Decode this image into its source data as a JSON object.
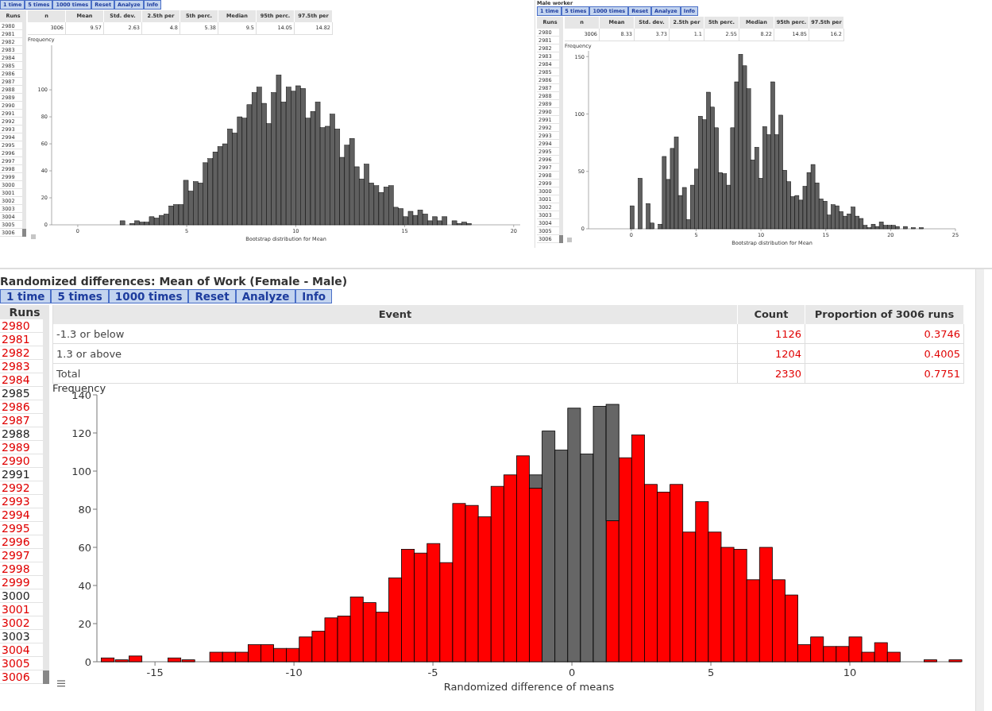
{
  "bootstrap_left": {
    "buttons": [
      "1 time",
      "5 times",
      "1000 times",
      "Reset",
      "Analyze",
      "Info"
    ],
    "runs_header": "Runs",
    "runs": [
      "2980",
      "2981",
      "2982",
      "2983",
      "2984",
      "2985",
      "2986",
      "2987",
      "2988",
      "2989",
      "2990",
      "2991",
      "2992",
      "2993",
      "2994",
      "2995",
      "2996",
      "2997",
      "2998",
      "2999",
      "3000",
      "3001",
      "3002",
      "3003",
      "3004",
      "3005",
      "3006"
    ],
    "stats": {
      "columns": [
        "n",
        "Mean",
        "Std. dev.",
        "2.5th per",
        "5th perc.",
        "Median",
        "95th perc.",
        "97.5th per"
      ],
      "values": [
        "3006",
        "9.57",
        "2.63",
        "4.8",
        "5.38",
        "9.5",
        "14.05",
        "14.82"
      ]
    },
    "chart_data": {
      "type": "bar",
      "xlabel": "Bootstrap distribution for Mean",
      "ylabel": "Frequency",
      "x": [
        2.05,
        2.27,
        2.5,
        2.72,
        2.95,
        3.17,
        3.39,
        3.62,
        3.84,
        4.07,
        4.29,
        4.51,
        4.74,
        4.96,
        5.19,
        5.41,
        5.63,
        5.86,
        6.08,
        6.31,
        6.53,
        6.75,
        6.98,
        7.2,
        7.43,
        7.65,
        7.87,
        8.1,
        8.32,
        8.55,
        8.77,
        8.99,
        9.22,
        9.44,
        9.67,
        9.89,
        10.11,
        10.34,
        10.56,
        10.79,
        11.01,
        11.23,
        11.46,
        11.68,
        11.91,
        12.13,
        12.35,
        12.58,
        12.8,
        13.03,
        13.25,
        13.47,
        13.7,
        13.92,
        14.15,
        14.37,
        14.59,
        14.82,
        15.04,
        15.27,
        15.49,
        15.71,
        15.94,
        16.16,
        16.39,
        16.61,
        16.83,
        17.06,
        17.28,
        17.51,
        17.73,
        17.95
      ],
      "values": [
        3,
        null,
        1,
        3,
        2,
        2,
        6,
        5,
        7,
        8,
        14,
        15,
        15,
        33,
        25,
        32,
        31,
        46,
        49,
        54,
        58,
        60,
        71,
        68,
        80,
        79,
        89,
        98,
        102,
        90,
        75,
        98,
        111,
        91,
        102,
        99,
        103,
        101,
        79,
        84,
        91,
        72,
        73,
        82,
        71,
        50,
        59,
        64,
        43,
        34,
        45,
        31,
        29,
        24,
        28,
        29,
        13,
        12,
        6,
        10,
        7,
        11,
        8,
        3,
        6,
        3,
        6,
        null,
        3,
        1,
        2,
        1
      ],
      "xlim": [
        -1.2,
        20.3
      ],
      "ylim": [
        0,
        133
      ],
      "xticks": [
        0,
        5,
        10,
        15,
        20
      ],
      "yticks": [
        0,
        20,
        40,
        60,
        80,
        100
      ]
    }
  },
  "bootstrap_right": {
    "title": "Male worker",
    "buttons": [
      "1 time",
      "5 times",
      "1000 times",
      "Reset",
      "Analyze",
      "Info"
    ],
    "runs_header": "Runs",
    "runs": [
      "2980",
      "2981",
      "2982",
      "2983",
      "2984",
      "2985",
      "2986",
      "2987",
      "2988",
      "2989",
      "2990",
      "2991",
      "2992",
      "2993",
      "2994",
      "2995",
      "2996",
      "2997",
      "2998",
      "2999",
      "3000",
      "3001",
      "3002",
      "3003",
      "3004",
      "3005",
      "3006"
    ],
    "stats": {
      "columns": [
        "n",
        "Mean",
        "Std. dev.",
        "2.5th per",
        "5th perc.",
        "Median",
        "95th perc.",
        "97.5th per"
      ],
      "values": [
        "3006",
        "8.33",
        "3.73",
        "1.1",
        "2.55",
        "8.22",
        "14.85",
        "16.2"
      ]
    },
    "chart_data": {
      "type": "bar",
      "xlabel": "Bootstrap distribution for Mean",
      "ylabel": "Frequency",
      "x": [
        0.06,
        0.37,
        0.68,
        0.99,
        1.3,
        1.61,
        1.92,
        2.23,
        2.54,
        2.85,
        3.16,
        3.47,
        3.78,
        4.09,
        4.4,
        4.71,
        5.02,
        5.33,
        5.64,
        5.95,
        6.26,
        6.57,
        6.88,
        7.19,
        7.5,
        7.81,
        8.12,
        8.43,
        8.74,
        9.05,
        9.36,
        9.67,
        9.98,
        10.29,
        10.6,
        10.91,
        11.22,
        11.53,
        11.84,
        12.15,
        12.46,
        12.77,
        13.08,
        13.39,
        13.7,
        14.01,
        14.32,
        14.63,
        14.94,
        15.25,
        15.56,
        15.87,
        16.18,
        16.49,
        16.8,
        17.11,
        17.42,
        17.73,
        18.04,
        18.35,
        18.66,
        18.97,
        19.28,
        19.59,
        19.9,
        20.21,
        20.52,
        20.83,
        21.14,
        21.45,
        21.76,
        22.07,
        22.38
      ],
      "values": [
        20,
        null,
        44,
        null,
        22,
        5,
        null,
        4,
        63,
        43,
        70,
        80,
        29,
        36,
        8,
        38,
        52,
        98,
        95,
        119,
        106,
        88,
        49,
        48,
        38,
        88,
        128,
        152,
        142,
        122,
        60,
        71,
        44,
        89,
        82,
        128,
        82,
        99,
        51,
        41,
        28,
        29,
        25,
        37,
        49,
        56,
        40,
        26,
        24,
        12,
        21,
        20,
        15,
        11,
        13,
        19,
        11,
        9,
        3,
        1,
        4,
        2,
        6,
        3,
        3,
        3,
        2,
        null,
        2,
        null,
        1,
        null,
        1
      ],
      "xlim": [
        -3.3,
        25
      ],
      "ylim": [
        0,
        155
      ],
      "xticks": [
        0,
        5,
        10,
        15,
        20,
        25
      ],
      "yticks": [
        0,
        50,
        100,
        150
      ]
    }
  },
  "randomization": {
    "title": "Randomized differences: Mean of Work (Female - Male)",
    "buttons": [
      "1 time",
      "5 times",
      "1000 times",
      "Reset",
      "Analyze",
      "Info"
    ],
    "runs_header": "Runs",
    "runs": [
      {
        "label": "2980",
        "in_event": true
      },
      {
        "label": "2981",
        "in_event": true
      },
      {
        "label": "2982",
        "in_event": true
      },
      {
        "label": "2983",
        "in_event": true
      },
      {
        "label": "2984",
        "in_event": true
      },
      {
        "label": "2985",
        "in_event": false
      },
      {
        "label": "2986",
        "in_event": true
      },
      {
        "label": "2987",
        "in_event": true
      },
      {
        "label": "2988",
        "in_event": false
      },
      {
        "label": "2989",
        "in_event": true
      },
      {
        "label": "2990",
        "in_event": true
      },
      {
        "label": "2991",
        "in_event": false
      },
      {
        "label": "2992",
        "in_event": true
      },
      {
        "label": "2993",
        "in_event": true
      },
      {
        "label": "2994",
        "in_event": true
      },
      {
        "label": "2995",
        "in_event": true
      },
      {
        "label": "2996",
        "in_event": true
      },
      {
        "label": "2997",
        "in_event": true
      },
      {
        "label": "2998",
        "in_event": true
      },
      {
        "label": "2999",
        "in_event": true
      },
      {
        "label": "3000",
        "in_event": false
      },
      {
        "label": "3001",
        "in_event": true
      },
      {
        "label": "3002",
        "in_event": true
      },
      {
        "label": "3003",
        "in_event": false
      },
      {
        "label": "3004",
        "in_event": true
      },
      {
        "label": "3005",
        "in_event": true
      },
      {
        "label": "3006",
        "in_event": true
      }
    ],
    "event_table": {
      "columns": [
        "Event",
        "Count",
        "Proportion of 3006 runs"
      ],
      "rows": [
        {
          "event": "-1.3 or below",
          "count": "1126",
          "proportion": "0.3746"
        },
        {
          "event": "1.3 or above",
          "count": "1204",
          "proportion": "0.4005"
        },
        {
          "event": "Total",
          "count": "2330",
          "proportion": "0.7751"
        }
      ]
    },
    "chart_data": {
      "type": "bar",
      "xlabel": "Randomized difference of means",
      "ylabel": "Frequency",
      "stacked": true,
      "x": [
        -16.7,
        -16.2,
        -15.7,
        -14.3,
        -13.8,
        -12.8,
        -12.34,
        -11.88,
        -11.42,
        -10.96,
        -10.5,
        -10.04,
        -9.58,
        -9.12,
        -8.66,
        -8.2,
        -7.74,
        -7.28,
        -6.82,
        -6.36,
        -5.9,
        -5.44,
        -4.98,
        -4.52,
        -4.06,
        -3.6,
        -3.14,
        -2.68,
        -2.22,
        -1.76,
        -1.3,
        -0.84,
        -0.38,
        0.08,
        0.54,
        1.0,
        1.46,
        1.92,
        2.38,
        2.84,
        3.3,
        3.76,
        4.22,
        4.68,
        5.14,
        5.6,
        6.06,
        6.52,
        6.98,
        7.44,
        7.9,
        8.36,
        8.82,
        9.28,
        9.74,
        10.2,
        10.66,
        11.12,
        11.58,
        12.9,
        13.8
      ],
      "series": [
        {
          "color": "#ff0000",
          "values": [
            2,
            1,
            3,
            2,
            1,
            5,
            5,
            5,
            9,
            9,
            7,
            7,
            13,
            16,
            23,
            24,
            34,
            31,
            26,
            44,
            59,
            57,
            62,
            52,
            83,
            82,
            76,
            92,
            98,
            108,
            91,
            null,
            null,
            null,
            null,
            null,
            74,
            107,
            119,
            93,
            89,
            93,
            68,
            84,
            68,
            60,
            59,
            43,
            60,
            43,
            35,
            9,
            13,
            8,
            8,
            13,
            5,
            10,
            5,
            1,
            1
          ]
        },
        {
          "color": "#666666",
          "values": [
            null,
            null,
            null,
            null,
            null,
            null,
            null,
            null,
            null,
            null,
            null,
            null,
            null,
            null,
            null,
            null,
            null,
            null,
            null,
            null,
            null,
            null,
            null,
            null,
            null,
            null,
            null,
            null,
            null,
            null,
            7,
            121,
            111,
            133,
            109,
            134,
            61,
            null,
            null,
            null,
            null,
            null,
            null,
            null,
            null,
            null,
            null,
            null,
            null,
            null,
            null,
            null,
            null,
            null,
            null,
            null,
            null,
            null,
            null,
            null,
            null
          ]
        }
      ],
      "xlim": [
        -17.09,
        14
      ],
      "ylim": [
        0,
        140
      ],
      "xticks": [
        -15,
        -10,
        -5,
        0,
        5,
        10
      ],
      "yticks": [
        0,
        20,
        40,
        60,
        80,
        100,
        120,
        140
      ]
    }
  }
}
